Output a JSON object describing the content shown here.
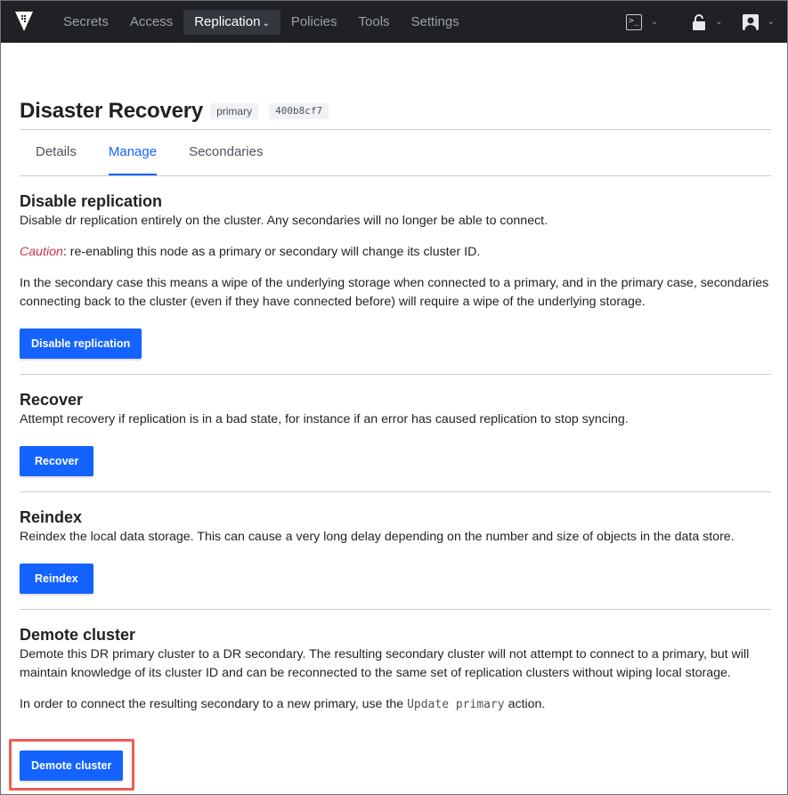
{
  "nav": {
    "items": [
      {
        "label": "Secrets"
      },
      {
        "label": "Access"
      },
      {
        "label": "Replication",
        "active": true
      },
      {
        "label": "Policies"
      },
      {
        "label": "Tools"
      },
      {
        "label": "Settings"
      }
    ],
    "active_caret": "⌄",
    "tools": [
      "console-icon",
      "lock-icon",
      "user-icon"
    ]
  },
  "header": {
    "title": "Disaster Recovery",
    "mode_badge": "primary",
    "id_badge": "400b8cf7"
  },
  "tabs": [
    {
      "label": "Details"
    },
    {
      "label": "Manage",
      "active": true
    },
    {
      "label": "Secondaries"
    }
  ],
  "sections": {
    "disable": {
      "title": "Disable replication",
      "desc": "Disable dr replication entirely on the cluster. Any secondaries will no longer be able to connect.",
      "caution_label": "Caution",
      "caution_text": ": re-enabling this node as a primary or secondary will change its cluster ID.",
      "detail": "In the secondary case this means a wipe of the underlying storage when connected to a primary, and in the primary case, secondaries connecting back to the cluster (even if they have connected before) will require a wipe of the underlying storage.",
      "button": "Disable replication"
    },
    "recover": {
      "title": "Recover",
      "desc": "Attempt recovery if replication is in a bad state, for instance if an error has caused replication to stop syncing.",
      "button": "Recover"
    },
    "reindex": {
      "title": "Reindex",
      "desc": "Reindex the local data storage. This can cause a very long delay depending on the number and size of objects in the data store.",
      "button": "Reindex"
    },
    "demote": {
      "title": "Demote cluster",
      "desc": "Demote this DR primary cluster to a DR secondary. The resulting secondary cluster will not attempt to connect to a primary, but will maintain knowledge of its cluster ID and can be reconnected to the same set of replication clusters without wiping local storage.",
      "detail_before": "In order to connect the resulting secondary to a new primary, use the ",
      "detail_code": "Update primary",
      "detail_after": " action.",
      "button": "Demote cluster"
    }
  },
  "colors": {
    "accent": "#1563ff",
    "nav_bg": "#1f2124",
    "caution": "#c73445",
    "highlight": "#ee5c53"
  }
}
